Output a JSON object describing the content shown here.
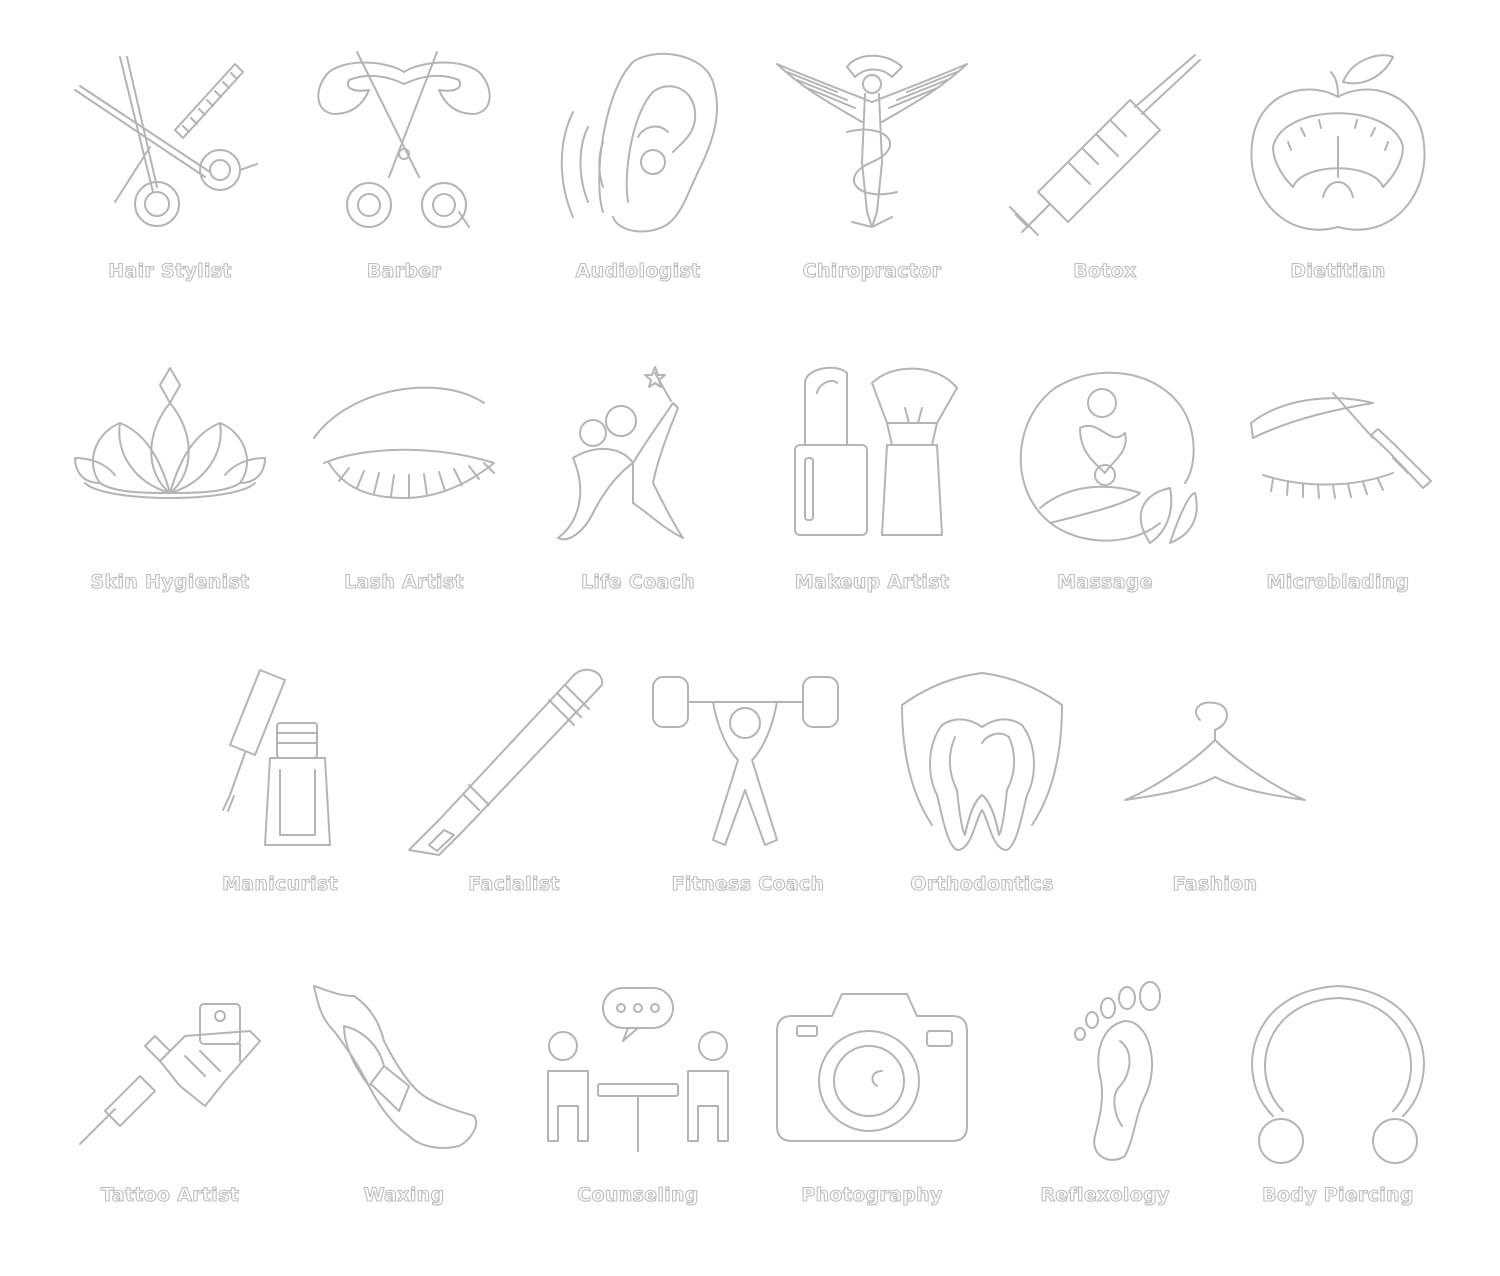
{
  "items": [
    {
      "label": "Hair Stylist",
      "icon": "scissors-comb-icon"
    },
    {
      "label": "Barber",
      "icon": "scissors-mustache-icon"
    },
    {
      "label": "Audiologist",
      "icon": "ear-soundwave-icon"
    },
    {
      "label": "Chiropractor",
      "icon": "winged-figure-icon"
    },
    {
      "label": "Botox",
      "icon": "syringe-icon"
    },
    {
      "label": "Dietitian",
      "icon": "apple-scale-icon"
    },
    {
      "label": "Skin Hygienist",
      "icon": "lotus-icon"
    },
    {
      "label": "Lash Artist",
      "icon": "eyelash-icon"
    },
    {
      "label": "Life Coach",
      "icon": "dancers-wand-icon"
    },
    {
      "label": "Makeup Artist",
      "icon": "lipstick-brush-icon"
    },
    {
      "label": "Massage",
      "icon": "massage-circle-icon"
    },
    {
      "label": "Microblading",
      "icon": "brow-pen-icon"
    },
    {
      "label": "Manicurist",
      "icon": "nail-polish-icon"
    },
    {
      "label": "Facialist",
      "icon": "scalpel-icon"
    },
    {
      "label": "Fitness Coach",
      "icon": "weightlifter-icon"
    },
    {
      "label": "Orthodontics",
      "icon": "tooth-shield-icon"
    },
    {
      "label": "Fashion",
      "icon": "hanger-icon"
    },
    {
      "label": "Tattoo Artist",
      "icon": "tattoo-machine-icon"
    },
    {
      "label": "Waxing",
      "icon": "waxed-leg-icon"
    },
    {
      "label": "Counseling",
      "icon": "conversation-table-icon"
    },
    {
      "label": "Photography",
      "icon": "camera-icon"
    },
    {
      "label": "Reflexology",
      "icon": "footprint-icon"
    },
    {
      "label": "Body Piercing",
      "icon": "horseshoe-ring-icon"
    }
  ]
}
